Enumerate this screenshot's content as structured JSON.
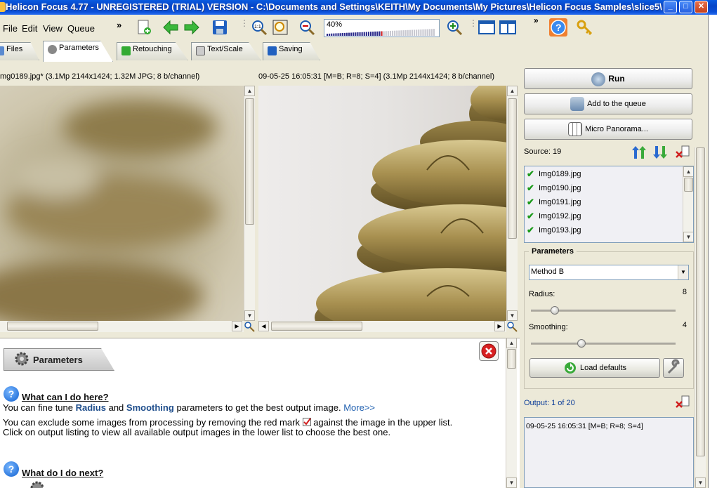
{
  "window": {
    "title": "Helicon Focus 4.77 - UNREGISTERED (TRIAL) VERSION - C:\\Documents and Settings\\KEITH\\My Documents\\My Pictures\\Helicon Focus Samples\\slice5\\"
  },
  "menu": [
    "File",
    "Edit",
    "View",
    "Queue"
  ],
  "zoom": {
    "label": "40%",
    "level": 0.5
  },
  "tabs": [
    "Files",
    "Parameters",
    "Retouching",
    "Text/Scale",
    "Saving"
  ],
  "panes": {
    "left_header": "mg0189.jpg* (3.1Mp 2144x1424; 1.32M JPG; 8 b/channel)",
    "right_header": "09-05-25 16:05:31 [M=B; R=8; S=4] (3.1Mp 2144x1424; 8 b/channel)"
  },
  "help": {
    "tab_label": "Parameters",
    "q1_heading": "What can I do here?",
    "q1_p1_pre": "You can fine tune",
    "q1_p1_radius": "Radius",
    "q1_p1_and": "and",
    "q1_p1_smoothing": "Smoothing",
    "q1_p1_post": "parameters to get the best output image.",
    "q1_more": "More>>",
    "q1_p2a": "You can exclude some images from processing by removing  the red mark",
    "q1_p2b": "against the image in the upper list.",
    "q1_p3": "Click on output  listing to view all available output images in the lower list to choose the best one.",
    "q2_heading": "What do I do next?"
  },
  "side": {
    "run_label": "Run",
    "add_queue_label": "Add to the queue",
    "micro_label": "Micro Panorama...",
    "source_label": "Source: 19",
    "source_items": [
      "Img0189.jpg",
      "Img0190.jpg",
      "Img0191.jpg",
      "Img0192.jpg",
      "Img0193.jpg"
    ],
    "params_title": "Parameters",
    "method": "Method B",
    "radius_label": "Radius:",
    "radius_value": "8",
    "smoothing_label": "Smoothing:",
    "smoothing_value": "4",
    "load_defaults_label": "Load defaults",
    "output_label": "Output: 1 of 20",
    "output_item": "09-05-25 16:05:31 [M=B; R=8; S=4]"
  }
}
